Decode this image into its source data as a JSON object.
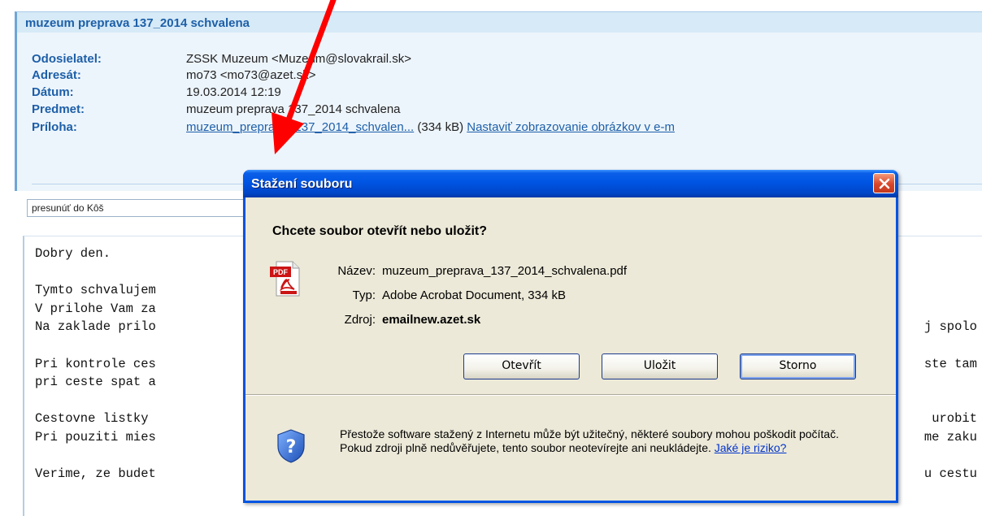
{
  "email": {
    "subject_bar": "muzeum preprava 137_2014 schvalena",
    "headers": [
      {
        "label": "Odosielatel:",
        "value": "ZSSK Muzeum <Muzeum@slovakrail.sk>"
      },
      {
        "label": "Adresát:",
        "value": "mo73 <mo73@azet.sk>"
      },
      {
        "label": "Dátum:",
        "value": "19.03.2014 12:19"
      },
      {
        "label": "Predmet:",
        "value": "muzeum preprava 137_2014 schvalena"
      }
    ],
    "attachment": {
      "label": "Príloha:",
      "file_link": "muzeum_preprava_137_2014_schvalen...",
      "size": "(334 kB)",
      "images_link": "Nastaviť zobrazovanie obrázkov v e-m"
    },
    "move_select": "presunúť do Kôš",
    "body_lines": [
      "Dobry den.",
      "",
      "Tymto schvalujem",
      "V prilohe Vam za",
      "Na zaklade prilo",
      "",
      "Pri kontrole ces",
      "pri ceste spat a",
      "",
      "Cestovne listky",
      "Pri pouziti mies",
      "",
      "Verime, ze budet"
    ],
    "body_right_fragments": [
      {
        "line": 4,
        "text": "j spolo"
      },
      {
        "line": 6,
        "text": "ste tam"
      },
      {
        "line": 9,
        "text": "urobit"
      },
      {
        "line": 10,
        "text": "me zaku"
      },
      {
        "line": 12,
        "text": "u cestu"
      }
    ]
  },
  "dialog": {
    "title": "Stažení souboru",
    "question": "Chcete soubor otevřít nebo uložit?",
    "file_icon": "pdf-file-icon",
    "pdf_badge": "PDF",
    "info": [
      {
        "label": "Název:",
        "value": "muzeum_preprava_137_2014_schvalena.pdf"
      },
      {
        "label": "Typ:",
        "value": "Adobe Acrobat Document, 334 kB"
      },
      {
        "label": "Zdroj:",
        "value": "emailnew.azet.sk"
      }
    ],
    "buttons": {
      "open": "Otevřít",
      "save": "Uložit",
      "cancel": "Storno"
    },
    "warning_text": "Přestože software stažený z Internetu může být užitečný, některé soubory mohou poškodit počítač. Pokud zdroji plně nedůvěřujete, tento soubor neotevírejte ani neukládejte.",
    "risk_link": "Jaké je riziko?",
    "colors": {
      "titlebar": "#0054e3",
      "body": "#ece9d8",
      "close": "#d8452a"
    }
  },
  "annotation": {
    "arrow_color": "#ff0000"
  }
}
